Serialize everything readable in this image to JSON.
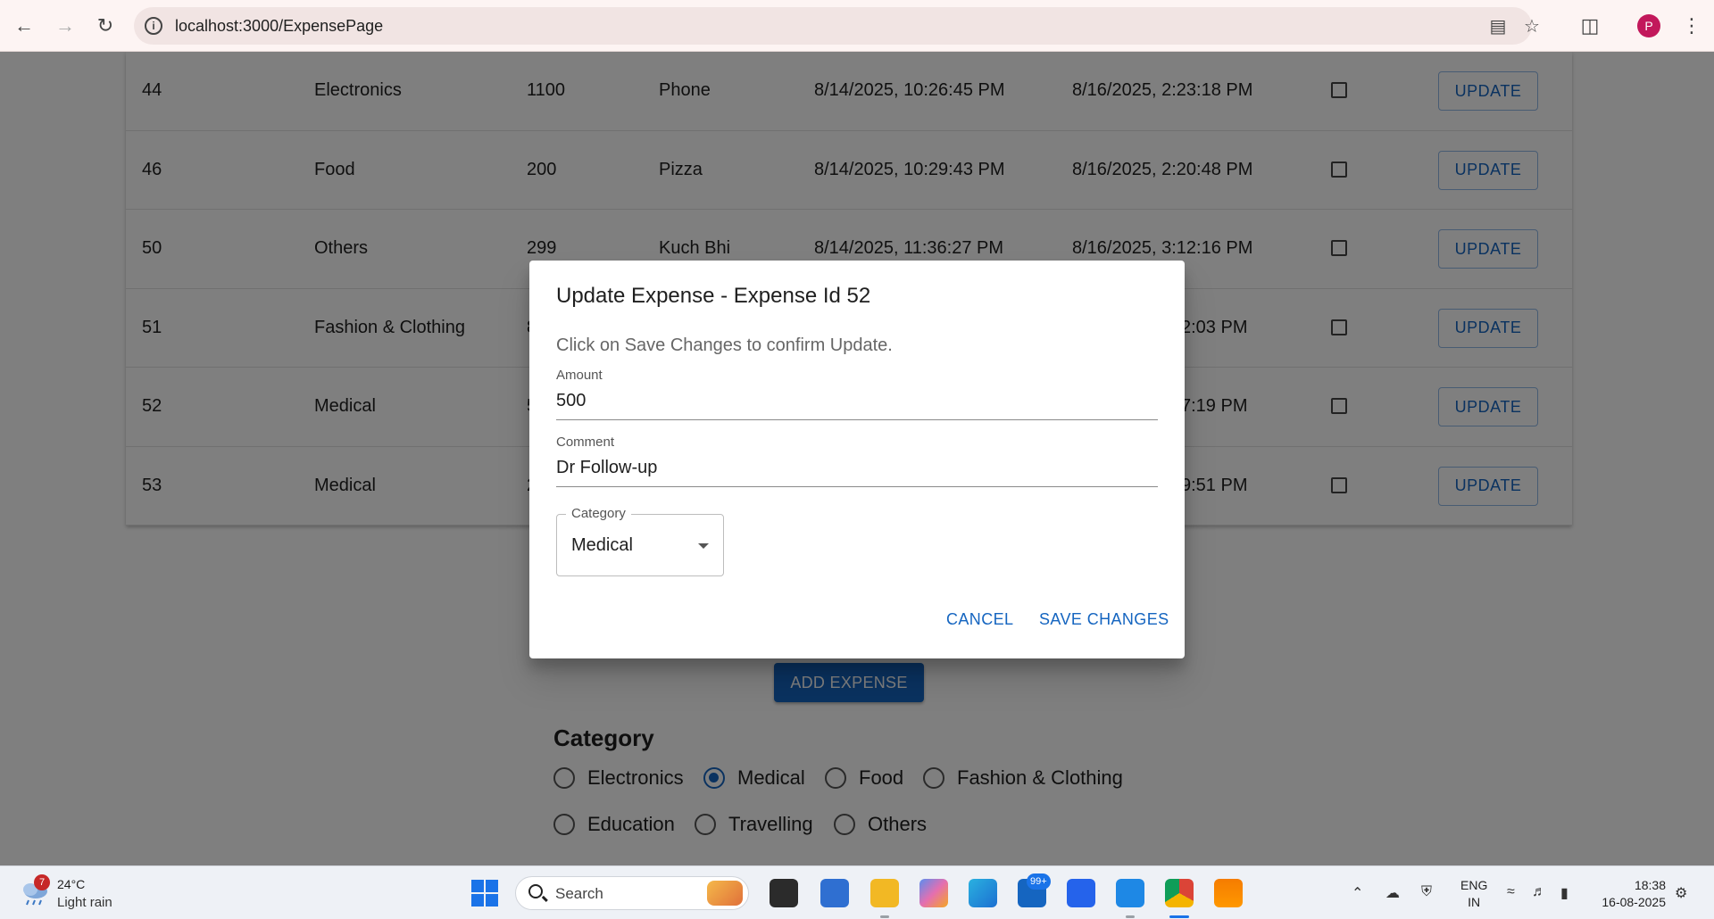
{
  "browser": {
    "url": "localhost:3000/ExpensePage"
  },
  "table": {
    "rows": [
      {
        "id": "44",
        "category": "Electronics",
        "amount": "1100",
        "comment": "Phone",
        "created": "8/14/2025, 10:26:45 PM",
        "updated": "8/16/2025, 2:23:18 PM",
        "button": "UPDATE"
      },
      {
        "id": "46",
        "category": "Food",
        "amount": "200",
        "comment": "Pizza",
        "created": "8/14/2025, 10:29:43 PM",
        "updated": "8/16/2025, 2:20:48 PM",
        "button": "UPDATE"
      },
      {
        "id": "50",
        "category": "Others",
        "amount": "299",
        "comment": "Kuch Bhi",
        "created": "8/14/2025, 11:36:27 PM",
        "updated": "8/16/2025, 3:12:16 PM",
        "button": "UPDATE"
      },
      {
        "id": "51",
        "category": "Fashion & Clothing",
        "amount": "8",
        "comment": "",
        "created": "",
        "updated": "2:03 PM",
        "button": "UPDATE"
      },
      {
        "id": "52",
        "category": "Medical",
        "amount": "5",
        "comment": "",
        "created": "",
        "updated": "7:19 PM",
        "button": "UPDATE"
      },
      {
        "id": "53",
        "category": "Medical",
        "amount": "2",
        "comment": "",
        "created": "",
        "updated": "9:51 PM",
        "button": "UPDATE"
      }
    ]
  },
  "add_button": "ADD EXPENSE",
  "category_filter": {
    "title": "Category",
    "options": [
      "Electronics",
      "Medical",
      "Food",
      "Fashion & Clothing",
      "Education",
      "Travelling",
      "Others"
    ],
    "selected": "Medical"
  },
  "dialog": {
    "title": "Update Expense - Expense Id 52",
    "text": "Click on Save Changes to confirm Update.",
    "amount_label": "Amount",
    "amount_value": "500",
    "comment_label": "Comment",
    "comment_value": "Dr Follow-up",
    "category_label": "Category",
    "category_value": "Medical",
    "cancel": "CANCEL",
    "save": "SAVE CHANGES"
  },
  "taskbar": {
    "weather_badge": "7",
    "temperature": "24°C",
    "condition": "Light rain",
    "search_placeholder": "Search",
    "mail_badge": "99+",
    "lang_line1": "ENG",
    "lang_line2": "IN",
    "time": "18:38",
    "date": "16-08-2025"
  },
  "colors": {
    "primary": "#1565c0",
    "avatar": "#c2185b"
  }
}
